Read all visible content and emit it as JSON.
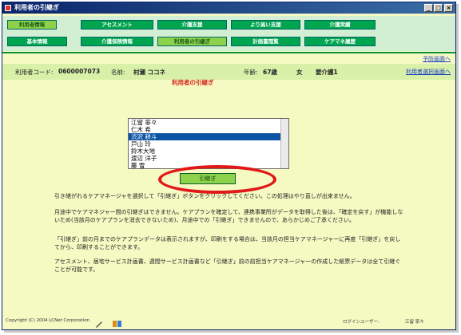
{
  "window": {
    "title": "利用者の引継ぎ"
  },
  "nav_row1": [
    "利用者情報",
    "アセスメント",
    "介護支援",
    "より高い支援",
    "介護実績"
  ],
  "nav_row2": [
    "基本情報",
    "介護保険情報",
    "利用者の引継ぎ",
    "計画書閲覧",
    "ケアマネ履歴"
  ],
  "links": {
    "schedule": "予防画面へ",
    "select_user": "利用者選択画面へ"
  },
  "user": {
    "code_label": "利用者コード:",
    "code": "0600007073",
    "name_label": "名前:",
    "name": "村瀬 ココネ",
    "age_label": "年齢:",
    "age": "67歳",
    "gender": "女",
    "care_level": "要介護1"
  },
  "section_title": "利用者の引継ぎ",
  "care_managers": [
    "江留 寧々",
    "仁木 希",
    "渋沢 耕斗",
    "戸山 玲",
    "鈴木大地",
    "渡辺 洋子",
    "藤 雪"
  ],
  "selected_index": 2,
  "action_button": "引継ぎ",
  "paragraphs": [
    "引き継がれるケアマネージャを選択して「引継ぎ」ボタンをクリックしてください。この処理はやり直しが出来ません。",
    "月途中でケアマネジャー間の引継ぎはできません。ケアプランを確定して、連携事業所がデータを取得した後は、「確定を戻す」が機能しないため(当該月のケアプランを消去できないため)、月途中での「引継ぎ」できませんので、あらかじめご了承ください。",
    "「引継ぎ」前の月までのケアプランデータは表示されますが、印刷をする場合は、当該月の担当ケアマネージャーに再度「引継ぎ」を戻してから、印刷することができます。",
    "アセスメント、居宅サービス計画書、週間サービス計画書など「引継ぎ」前の前担当ケアマネージャーの作成した帳票データは全て引継ぐことが可能です。"
  ],
  "footer": {
    "copyright": "Copyright (C) 2004 LCNet Corporation",
    "login_label": "ログインユーザー:",
    "login_user": "江留 寧々"
  },
  "colors": {
    "nav_bg": "#00a64f",
    "nav_active": "#8ed24b",
    "page_bg": "#f5f9c2",
    "highlight_ring": "#e01818",
    "link": "#1c3fc7"
  }
}
